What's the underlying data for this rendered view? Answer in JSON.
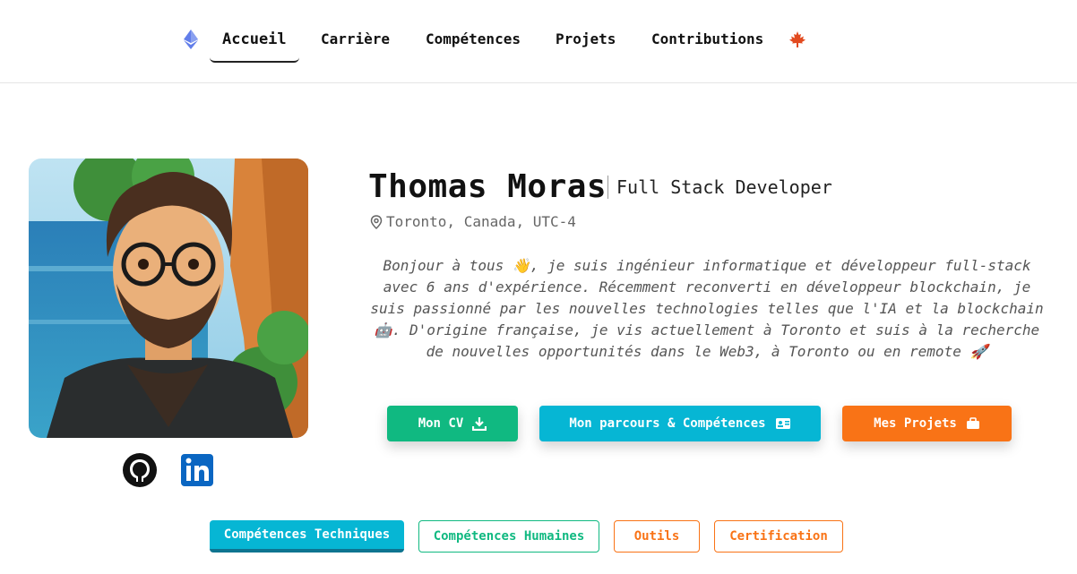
{
  "nav": {
    "items": [
      {
        "label": "Accueil",
        "active": true
      },
      {
        "label": "Carrière"
      },
      {
        "label": "Compétences"
      },
      {
        "label": "Projets"
      },
      {
        "label": "Contributions"
      }
    ],
    "logo_icon": "ethereum-icon",
    "flag_icon": "maple-leaf-icon"
  },
  "profile": {
    "name": "Thomas Moras",
    "role": "Full Stack Developer",
    "location": "Toronto, Canada, UTC-4",
    "bio": "Bonjour à tous 👋, je suis ingénieur informatique et développeur full-stack avec 6 ans d'expérience. Récemment reconverti en développeur blockchain, je suis passionné par les nouvelles technologies telles que l'IA et la blockchain 🤖. D'origine française, je vis actuellement à Toronto et suis à la recherche de nouvelles opportunités dans le Web3, à Toronto ou en remote 🚀",
    "social": [
      "github-icon",
      "linkedin-icon"
    ]
  },
  "actions": {
    "cv": "Mon CV",
    "parcours": "Mon parcours & Compétences",
    "projets": "Mes Projets"
  },
  "tabs": {
    "tech": "Compétences Techniques",
    "humaines": "Compétences Humaines",
    "outils": "Outils",
    "certification": "Certification"
  },
  "colors": {
    "green": "#10b981",
    "cyan": "#06b6d4",
    "orange": "#f97316"
  }
}
